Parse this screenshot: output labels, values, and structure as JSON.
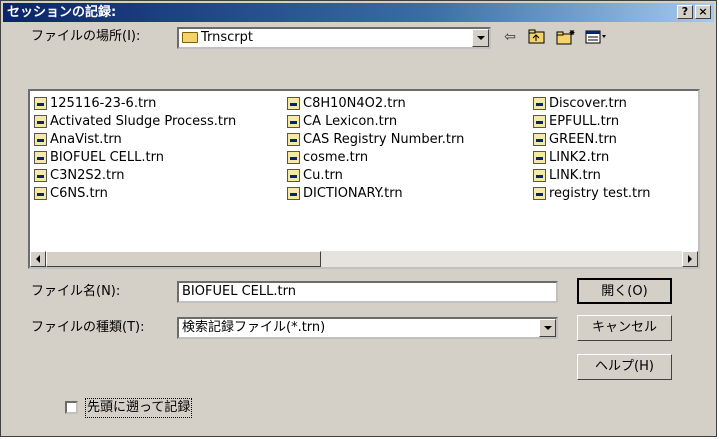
{
  "dialog": {
    "title": "セッションの記録:",
    "help_btn": "?",
    "close_btn": "×"
  },
  "location": {
    "label": "ファイルの場所(I):",
    "value": "Trnscrpt"
  },
  "toolbar": {
    "back_icon": "back-arrow-icon",
    "up_icon": "up-folder-icon",
    "new_icon": "new-folder-icon",
    "view_icon": "view-menu-icon"
  },
  "files": {
    "col1": [
      "125116-23-6.trn",
      "Activated Sludge Process.trn",
      "AnaVist.trn",
      "BIOFUEL CELL.trn",
      "C3N2S2.trn",
      "C6NS.trn"
    ],
    "col2": [
      "C8H10N4O2.trn",
      "CA Lexicon.trn",
      "CAS Registry Number.trn",
      "cosme.trn",
      "Cu.trn",
      "DICTIONARY.trn"
    ],
    "col3": [
      "Discover.trn",
      "EPFULL.trn",
      "GREEN.trn",
      "LINK2.trn",
      "LINK.trn",
      "registry test.trn"
    ]
  },
  "filename": {
    "label": "ファイル名(N):",
    "value": "BIOFUEL CELL.trn"
  },
  "filetype": {
    "label": "ファイルの種類(T):",
    "value": "検索記録ファイル(*.trn)"
  },
  "buttons": {
    "open": "開く(O)",
    "cancel": "キャンセル",
    "help": "ヘルプ(H)"
  },
  "checkbox": {
    "label": "先頭に遡って記録",
    "checked": false
  }
}
